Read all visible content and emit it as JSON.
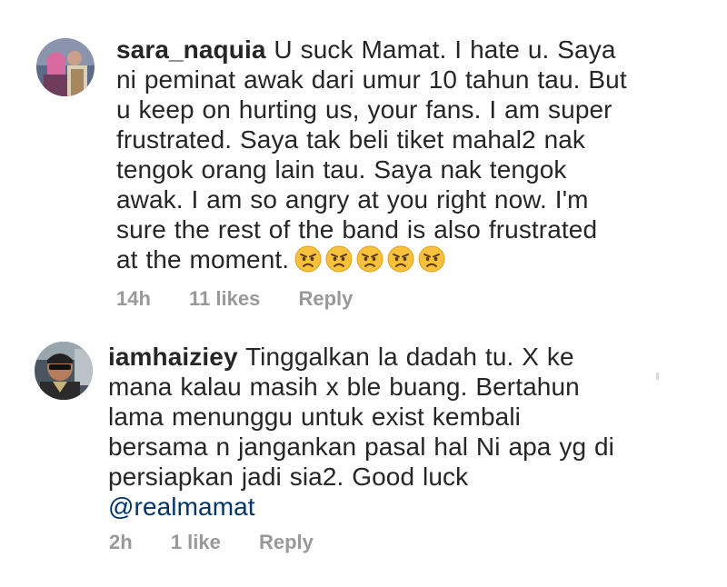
{
  "comments": [
    {
      "username": "sara_naquia",
      "lines": [
        "U suck Mamat. I hate u. Saya",
        "ni peminat awak dari umur 10 tahun tau. But",
        "u keep on hurting us, your fans. I am super",
        "frustrated. Saya tak beli tiket mahal2 nak",
        "tengok orang lain tau. Saya nak tengok",
        "awak. I am so angry at you right now. I'm",
        "sure the rest of the band is also frustrated",
        "at the moment."
      ],
      "emoji": [
        "angry-face",
        "angry-face",
        "angry-face",
        "angry-face",
        "angry-face"
      ],
      "time": "14h",
      "likes": "11 likes",
      "reply": "Reply"
    },
    {
      "username": "iamhaiziey",
      "lines": [
        "Tinggalkan la dadah tu. X ke",
        "mana kalau masih x ble buang. Bertahun",
        "lama menunggu untuk exist kembali",
        "bersama n jangankan pasal hal Ni apa yg di",
        "persiapkan jadi sia2. Good luck"
      ],
      "mention": "@realmamat",
      "time": "2h",
      "likes": "1 like",
      "reply": "Reply"
    }
  ],
  "colors": {
    "text": "#262626",
    "meta": "#999999",
    "mention": "#003569",
    "emoji_face": "#f7c23a"
  }
}
